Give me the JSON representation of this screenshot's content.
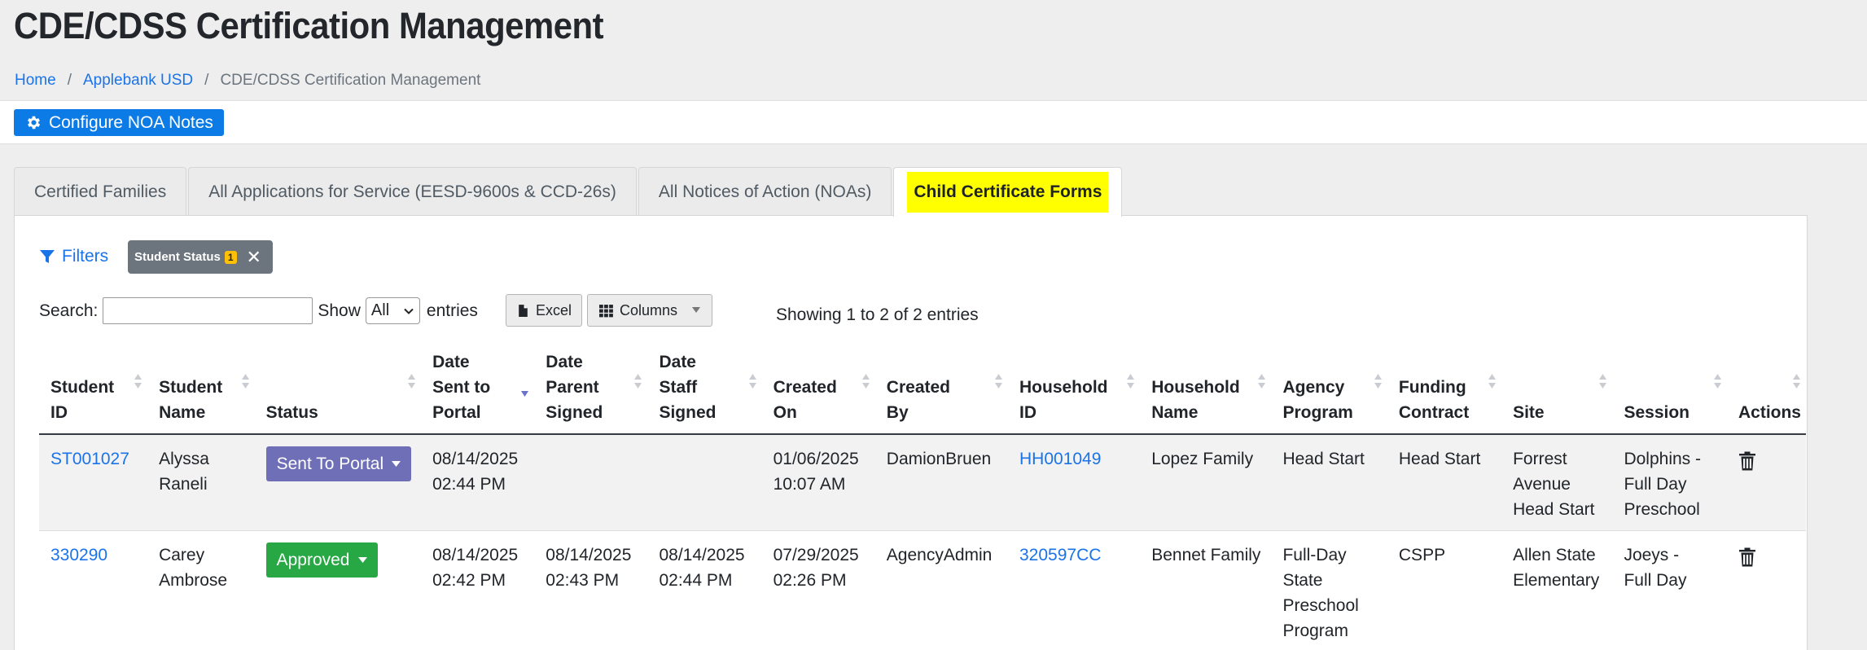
{
  "page": {
    "title": "CDE/CDSS Certification Management"
  },
  "breadcrumb": {
    "items": [
      "Home",
      "Applebank USD"
    ],
    "current": "CDE/CDSS Certification Management",
    "separator": "/"
  },
  "toolbar": {
    "noa_button": "Configure NOA Notes"
  },
  "tabs": [
    {
      "label": "Certified Families"
    },
    {
      "label": "All Applications for Service (EESD-9600s & CCD-26s)"
    },
    {
      "label": "All Notices of Action (NOAs)"
    },
    {
      "label": "Child Certificate Forms"
    }
  ],
  "filters": {
    "label": "Filters",
    "chip_label": "Student Status",
    "chip_count": "1",
    "chip_close": "✕"
  },
  "search": {
    "label": "Search:",
    "value": "",
    "show_label": "Show",
    "show_value": "All",
    "entries_label": "entries",
    "excel_button": "Excel",
    "columns_button": "Columns",
    "showing_text": "Showing 1 to 2 of 2 entries"
  },
  "table": {
    "headers": [
      [
        "Student",
        "ID"
      ],
      [
        "Student",
        "Name"
      ],
      [
        "Status"
      ],
      [
        "Date",
        "Sent to",
        "Portal"
      ],
      [
        "Date",
        "Parent",
        "Signed"
      ],
      [
        "Date",
        "Staff",
        "Signed"
      ],
      [
        "Created",
        "On"
      ],
      [
        "Created",
        "By"
      ],
      [
        "Household",
        "ID"
      ],
      [
        "Household",
        "Name"
      ],
      [
        "Agency",
        "Program"
      ],
      [
        "Funding",
        "Contract"
      ],
      [
        "Site"
      ],
      [
        "Session"
      ],
      [
        "Actions"
      ]
    ],
    "rows": [
      {
        "student_id": "ST001027",
        "student_name": [
          "Alyssa",
          "Raneli"
        ],
        "status": "Sent To Portal",
        "status_color": "#6f6fb8",
        "date_sent": [
          "08/14/2025",
          "02:44 PM"
        ],
        "date_parent": [
          "",
          ""
        ],
        "date_staff": [
          "",
          ""
        ],
        "created_on": [
          "01/06/2025",
          "10:07 AM"
        ],
        "created_by": "DamionBruen",
        "household_id": "HH001049",
        "household_name": "Lopez Family",
        "agency_program": [
          "Head Start"
        ],
        "funding_contract": "Head Start",
        "site": [
          "Forrest",
          "Avenue",
          "Head Start"
        ],
        "session": [
          "Dolphins -",
          "Full Day",
          "Preschool"
        ]
      },
      {
        "student_id": "330290",
        "student_name": [
          "Carey",
          "Ambrose"
        ],
        "status": "Approved",
        "status_color": "#28a745",
        "date_sent": [
          "08/14/2025",
          "02:42 PM"
        ],
        "date_parent": [
          "08/14/2025",
          "02:43 PM"
        ],
        "date_staff": [
          "08/14/2025",
          "02:44 PM"
        ],
        "created_on": [
          "07/29/2025",
          "02:26 PM"
        ],
        "created_by": "AgencyAdmin",
        "household_id": "320597CC",
        "household_name": "Bennet Family",
        "agency_program": [
          "Full-Day",
          "State",
          "Preschool",
          "Program"
        ],
        "funding_contract": "CSPP",
        "site": [
          "Allen State",
          "Elementary"
        ],
        "session": [
          "Joeys -",
          "Full Day"
        ]
      }
    ]
  },
  "colors": {
    "primary": "#0d7be6",
    "link": "#1a73e8",
    "highlight": "#ffff00",
    "chip": "#6c757d",
    "badge": "#ffc107"
  }
}
